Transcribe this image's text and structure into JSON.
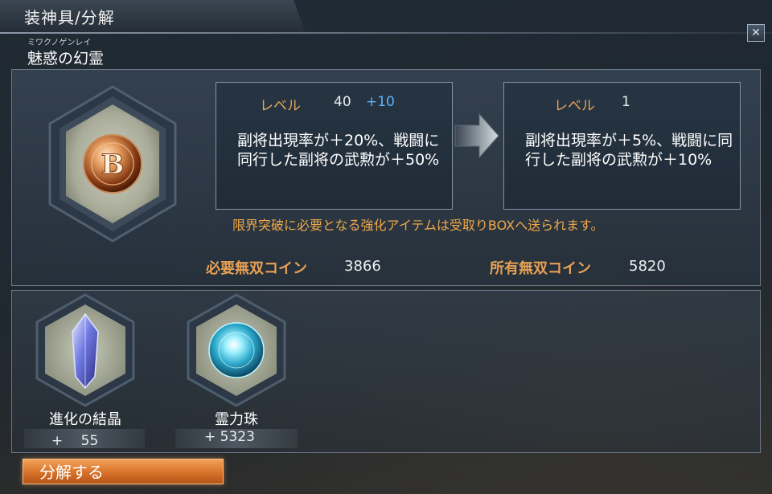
{
  "window": {
    "title": "装神具/分解",
    "close_glyph": "✕"
  },
  "item": {
    "ruby": "ミワクノゲンレイ",
    "name": "魅惑の幻霊",
    "emblem_letter": "B"
  },
  "current": {
    "level_label": "レベル",
    "level": "40",
    "level_plus": "+10",
    "description": "副将出現率が＋20%、戦闘に同行した副将の武勲が＋50%"
  },
  "result": {
    "level_label": "レベル",
    "level": "1",
    "description": "副将出現率が＋5%、戦闘に同行した副将の武勲が＋10%"
  },
  "notice": "限界突破に必要となる強化アイテムは受取りBOXへ送られます。",
  "coins": {
    "required_label": "必要無双コイン",
    "required_value": "3866",
    "owned_label": "所有無双コイン",
    "owned_value": "5820"
  },
  "materials": [
    {
      "name": "進化の結晶",
      "count": "+　 55",
      "icon": "crystal-icon"
    },
    {
      "name": "霊力珠",
      "count": "+ 5323",
      "icon": "spirit-orb-icon"
    }
  ],
  "actions": {
    "decompose_label": "分解する"
  },
  "colors": {
    "accent_orange": "#e8a458",
    "plus_blue": "#5ab4ff",
    "button_orange": "#d8722a"
  }
}
